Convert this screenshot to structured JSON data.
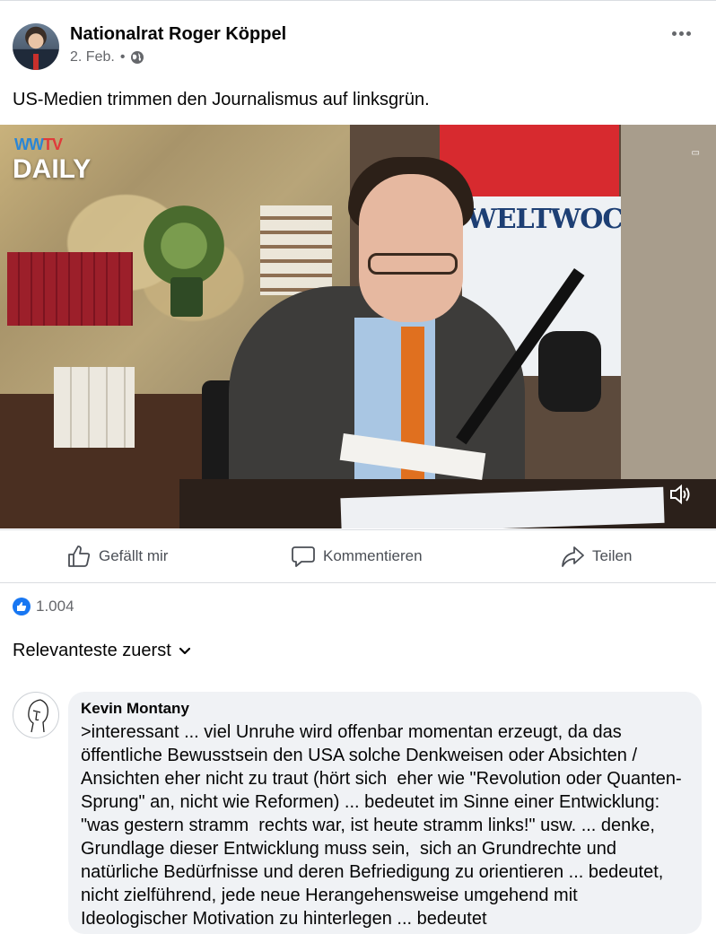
{
  "post": {
    "author": "Nationalrat Roger Köppel",
    "date": "2. Feb.",
    "separator": "•",
    "privacy_icon": "globe-icon",
    "more_icon": "more-horizontal-icon",
    "text": "US-Medien trimmen den Journalismus auf linksgrün."
  },
  "video": {
    "logo_top_part1": "WW",
    "logo_top_part2": "TV",
    "logo_bottom": "DAILY",
    "sign_text": "WELTWOCHE",
    "volume_icon": "volume-icon"
  },
  "actions": {
    "like_label": "Gefällt mir",
    "comment_label": "Kommentieren",
    "share_label": "Teilen"
  },
  "reactions": {
    "count": "1.004"
  },
  "sort": {
    "label": "Relevanteste zuerst"
  },
  "comments": [
    {
      "author": "Kevin Montany",
      "text": ">interessant ... viel Unruhe wird offenbar momentan erzeugt, da das öffentliche Bewusstsein den USA solche Denkweisen oder Absichten / Ansichten eher nicht zu traut (hört sich  eher wie \"Revolution oder Quanten- Sprung\" an, nicht wie Reformen) ... bedeutet im Sinne einer Entwicklung: \"was gestern stramm  rechts war, ist heute stramm links!\" usw. ... denke, Grundlage dieser Entwicklung muss sein,  sich an Grundrechte und natürliche Bedürfnisse und deren Befriedigung zu orientieren ... bedeutet, nicht zielführend, jede neue Herangehensweise umgehend mit Ideologischer Motivation zu hinterlegen ... bedeutet"
    }
  ],
  "colors": {
    "facebook_blue": "#1877f2",
    "secondary_text": "#65676b",
    "bubble_bg": "#f0f2f5",
    "divider": "#dadde1"
  }
}
